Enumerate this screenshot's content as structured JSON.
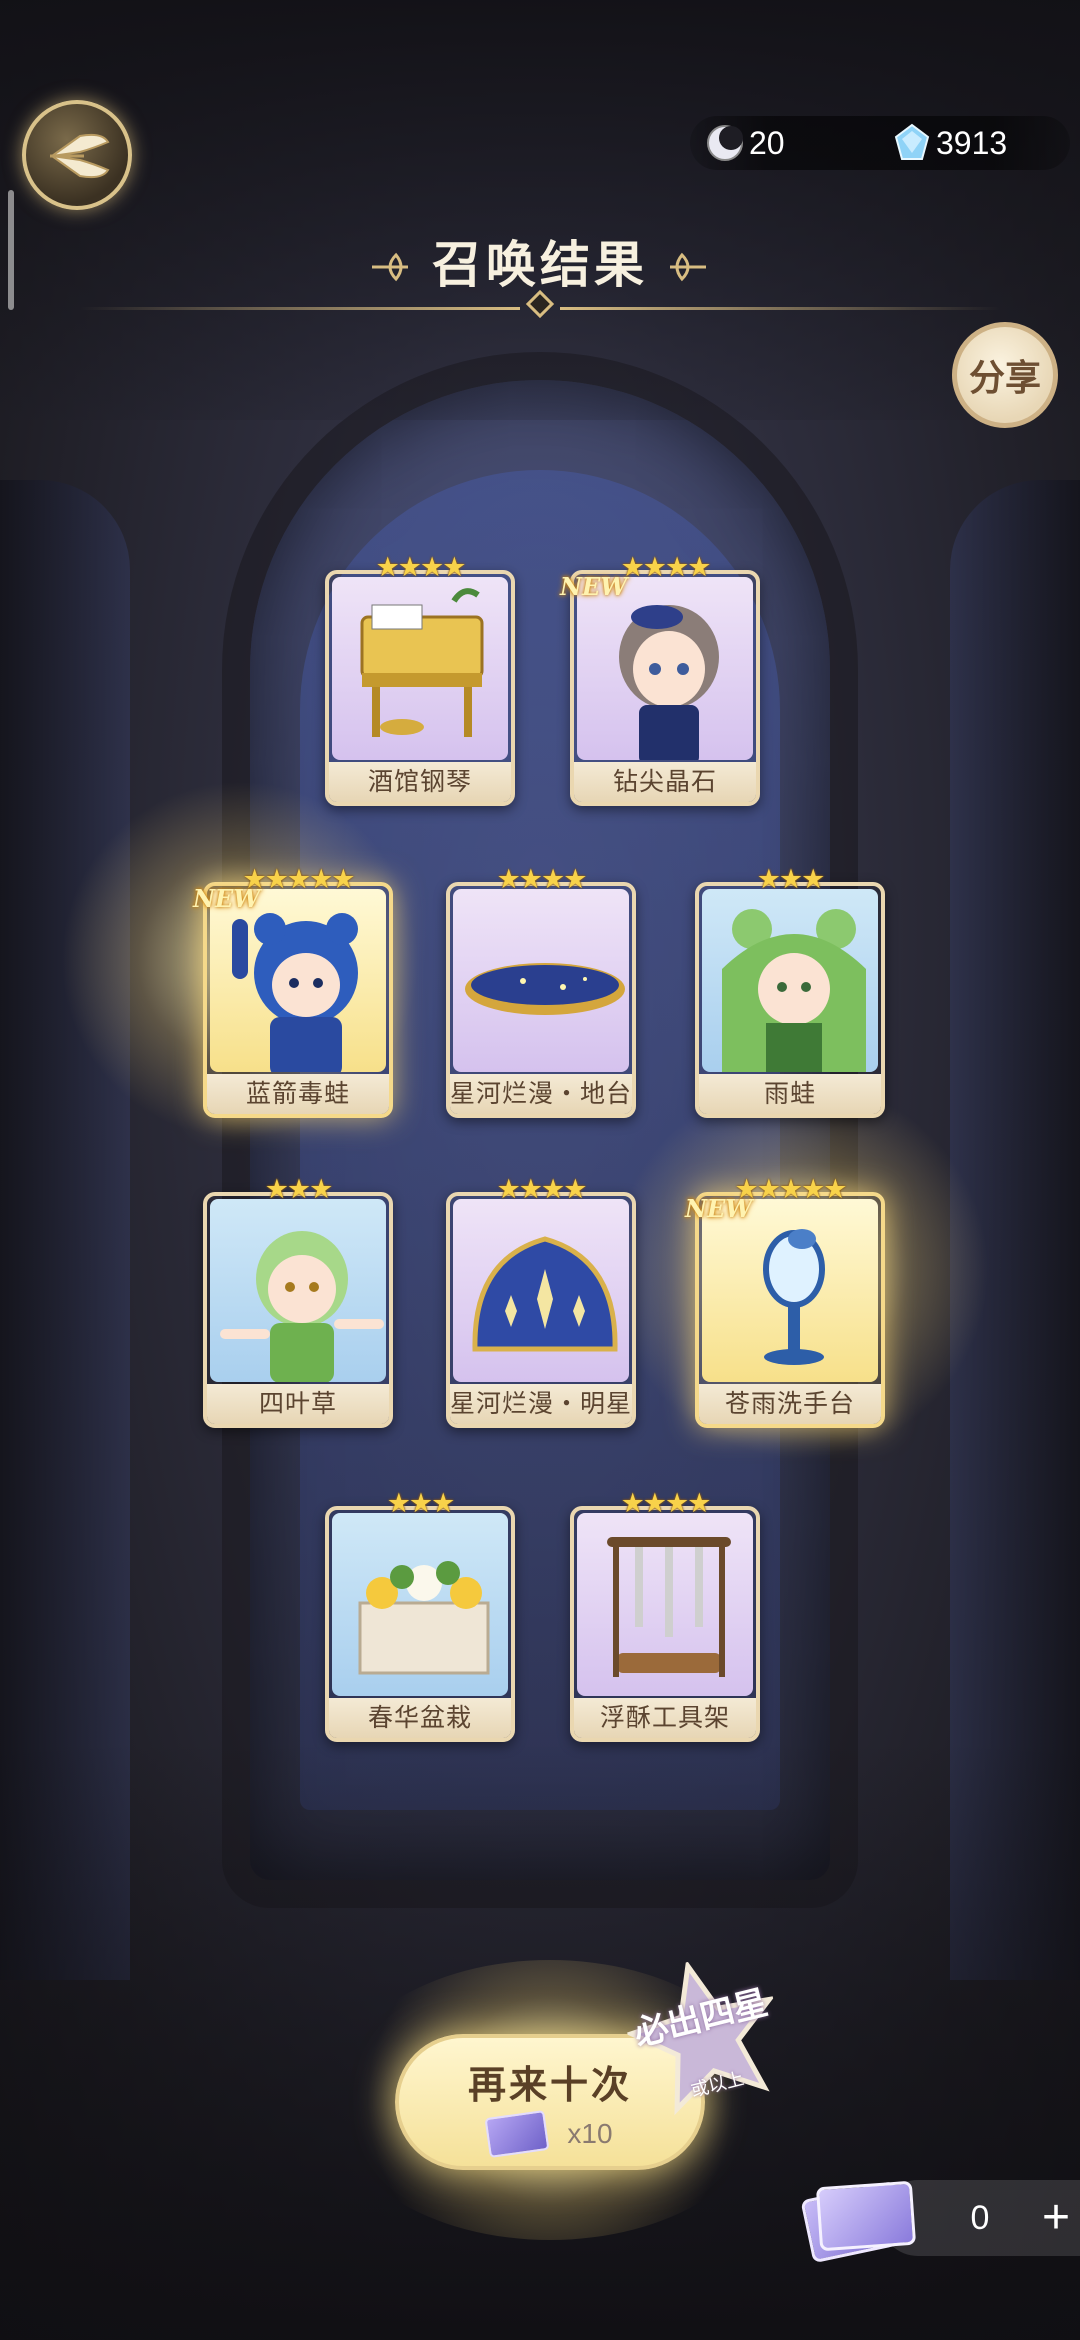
{
  "header": {
    "currencies": [
      {
        "icon": "moon-coin-icon",
        "value": "20"
      },
      {
        "icon": "crystal-icon",
        "value": "3913"
      }
    ],
    "title": "召唤结果",
    "share_label": "分享"
  },
  "results": [
    {
      "name": "酒馆钢琴",
      "stars": 4,
      "new": false
    },
    {
      "name": "钻尖晶石",
      "stars": 4,
      "new": true
    },
    {
      "name": "蓝箭毒蛙",
      "stars": 5,
      "new": true
    },
    {
      "name": "星河烂漫・地台",
      "stars": 4,
      "new": false
    },
    {
      "name": "雨蛙",
      "stars": 3,
      "new": false
    },
    {
      "name": "四叶草",
      "stars": 3,
      "new": false
    },
    {
      "name": "星河烂漫・明星",
      "stars": 4,
      "new": false
    },
    {
      "name": "苍雨洗手台",
      "stars": 5,
      "new": true
    },
    {
      "name": "春华盆栽",
      "stars": 3,
      "new": false
    },
    {
      "name": "浮酥工具架",
      "stars": 4,
      "new": false
    }
  ],
  "new_badge_text": "NEW",
  "footer": {
    "again_label": "再来十次",
    "again_cost": "x10",
    "guarantee_text": "必出四星",
    "guarantee_sub": "或以上",
    "ticket_count": "0",
    "plus_label": "+"
  }
}
